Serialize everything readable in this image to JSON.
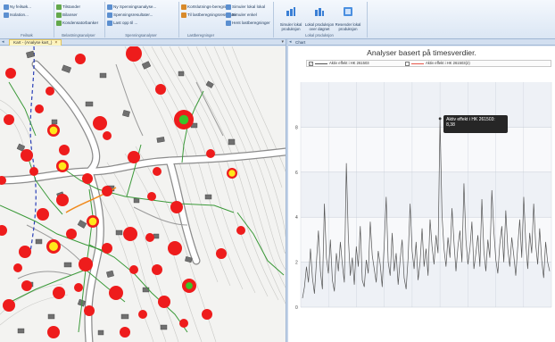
{
  "ribbon": {
    "groups": [
      {
        "caption": "Feilsøk",
        "items": [
          {
            "label": "Ny feilsøk... ",
            "icon": "search-icon"
          },
          {
            "label": "Isolation...",
            "icon": "isolate-icon"
          }
        ]
      },
      {
        "caption": "Belastningsanalyser",
        "items": [
          {
            "label": "Tilstander",
            "icon": "state-icon"
          },
          {
            "label": "Bilanser",
            "icon": "balance-icon"
          },
          {
            "label": "Kondensatorbanker",
            "icon": "capacitor-icon"
          }
        ]
      },
      {
        "caption": "Spenningsanalyser",
        "items": [
          {
            "label": "Ny Spenningsanalyse...",
            "icon": "voltage-icon"
          },
          {
            "label": "Spenningsresultater...",
            "icon": "voltage-result-icon"
          },
          {
            "label": "Last opp til ... ",
            "icon": "upload-icon"
          }
        ]
      },
      {
        "caption": "Lastberegninger",
        "items": [
          {
            "label": "Kortslutnings-beregning",
            "icon": "shortcircuit-icon"
          },
          {
            "label": "Til lastberegningsresultater",
            "icon": "load-result-icon"
          }
        ]
      },
      {
        "caption": "",
        "items": [
          {
            "label": "Simuler lokal lokal",
            "icon": "simulate-icon"
          },
          {
            "label": "Simuler enkel",
            "icon": "simulate-single-icon"
          },
          {
            "label": "Hent lastberegninger",
            "icon": "fetch-icon"
          }
        ]
      },
      {
        "caption": "Lokal produksjon",
        "buttons": [
          {
            "label": "Simuler lokal produksjon",
            "icon": "local-production-icon"
          },
          {
            "label": "Lokal produksjon over døgnet",
            "icon": "daily-production-icon"
          },
          {
            "label": "Resender lokal produksjon",
            "icon": "resend-production-icon"
          }
        ]
      }
    ]
  },
  "map_panel": {
    "tab_label": "Kart - (Analyse kart_)",
    "close_glyph": "×"
  },
  "chart_panel": {
    "header_label": "Chart",
    "title": "Analyser basert på timesverdier.",
    "legend": [
      {
        "label": "Aktiv effekt i HK 261503",
        "color": "#555555",
        "checked": true
      },
      {
        "label": "Aktiv effekt i HK 261503(2)",
        "color": "#e8584a",
        "checked": false
      }
    ],
    "tooltip": {
      "line1": "Aktiv effekt i HK 261503:",
      "line2": "8,38"
    }
  },
  "chart_data": {
    "type": "line",
    "title": "Analyser basert på timesverdier.",
    "ylim": [
      0,
      10
    ],
    "yticks": [
      "0",
      "2",
      "4",
      "6",
      "8"
    ],
    "series": [
      {
        "name": "Aktiv effekt i HK 261503",
        "color": "#555555",
        "values": [
          0.4,
          0.9,
          1.8,
          1.1,
          2.6,
          1.3,
          0.6,
          2.0,
          3.4,
          1.6,
          0.8,
          4.6,
          2.2,
          1.5,
          3.0,
          1.2,
          0.7,
          2.4,
          1.6,
          2.9,
          1.9,
          1.1,
          6.4,
          3.1,
          1.4,
          2.2,
          1.0,
          2.7,
          1.8,
          3.6,
          1.2,
          0.9,
          2.1,
          1.5,
          3.8,
          2.3,
          1.7,
          1.1,
          2.5,
          1.9,
          0.9,
          2.8,
          4.9,
          2.0,
          1.4,
          3.3,
          1.6,
          2.4,
          1.0,
          2.1,
          3.0,
          1.3,
          0.8,
          2.2,
          4.6,
          2.5,
          1.7,
          2.9,
          1.2,
          2.0,
          3.5,
          1.8,
          2.6,
          1.4,
          3.9,
          2.7,
          1.9,
          3.2,
          2.4,
          8.38,
          4.1,
          2.6,
          1.8,
          3.1,
          2.2,
          4.4,
          2.9,
          1.6,
          2.7,
          3.4,
          2.0,
          5.5,
          3.0,
          1.9,
          2.6,
          3.8,
          1.7,
          2.4,
          3.2,
          1.8,
          4.8,
          2.5,
          1.6,
          3.0,
          2.2,
          5.2,
          3.4,
          2.1,
          1.5,
          2.8,
          3.6,
          2.0,
          4.3,
          2.6,
          1.8,
          3.1,
          2.3,
          1.4,
          2.7,
          3.9,
          2.2,
          4.9,
          2.9,
          1.7,
          3.3,
          2.4,
          4.6,
          2.8,
          1.9,
          3.5,
          2.1,
          1.3,
          2.9,
          2.0,
          1.6
        ]
      }
    ]
  },
  "map_data": {
    "consumers_red": 46,
    "consumers_yellow_ring": 6,
    "consumers_green_center": 2
  }
}
